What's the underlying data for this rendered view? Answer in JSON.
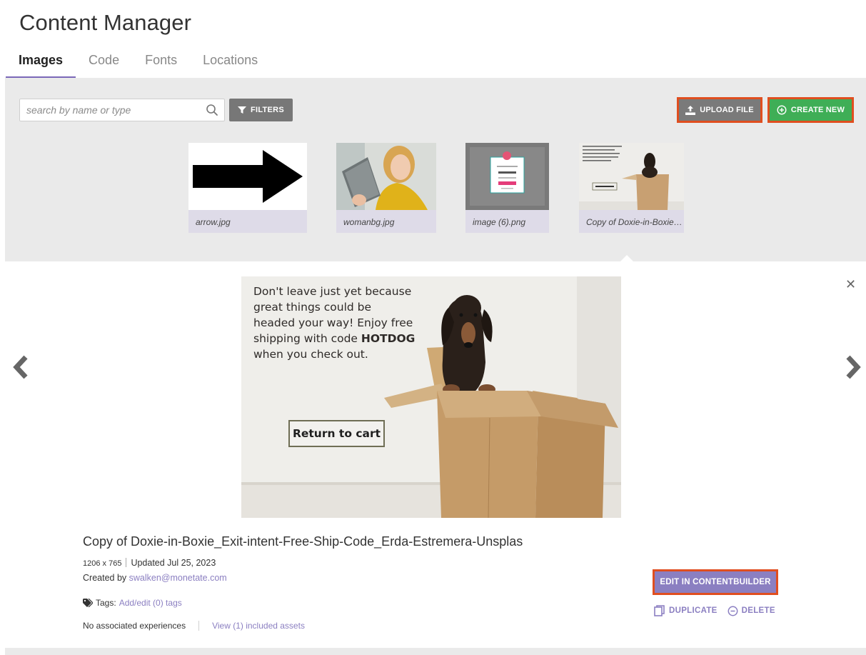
{
  "page": {
    "title": "Content Manager"
  },
  "tabs": [
    {
      "label": "Images",
      "active": true
    },
    {
      "label": "Code",
      "active": false
    },
    {
      "label": "Fonts",
      "active": false
    },
    {
      "label": "Locations",
      "active": false
    }
  ],
  "toolbar": {
    "search_placeholder": "search by name or type",
    "filters_label": "FILTERS",
    "upload_label": "UPLOAD FILE",
    "create_label": "CREATE NEW"
  },
  "thumbnails": [
    {
      "caption": "arrow.jpg"
    },
    {
      "caption": "womanbg.jpg"
    },
    {
      "caption": "image (6).png"
    },
    {
      "caption": "Copy of Doxie-in-Boxie…"
    }
  ],
  "preview": {
    "text_lines": [
      "Don't leave just yet because",
      "great things could be",
      "headed your way! Enjoy free",
      "shipping with code "
    ],
    "code": "HOTDOG",
    "last_line": "when you check out.",
    "button_label": "Return to cart"
  },
  "detail": {
    "title": "Copy of Doxie-in-Boxie_Exit-intent-Free-Ship-Code_Erda-Estremera-Unsplas",
    "dimensions": "1206 x 765",
    "updated": "Updated Jul 25, 2023",
    "created_prefix": "Created by ",
    "created_by": "swalken@monetate.com",
    "tags_label": "Tags:",
    "tags_link": "Add/edit (0) tags",
    "no_experiences": "No associated experiences",
    "included_assets": "View (1) included assets",
    "edit_label": "EDIT IN CONTENTBUILDER",
    "duplicate_label": "DUPLICATE",
    "delete_label": "DELETE"
  },
  "colors": {
    "accent": "#8b7fc1",
    "create_green": "#3fae56",
    "highlight_border": "#e04e1f"
  }
}
